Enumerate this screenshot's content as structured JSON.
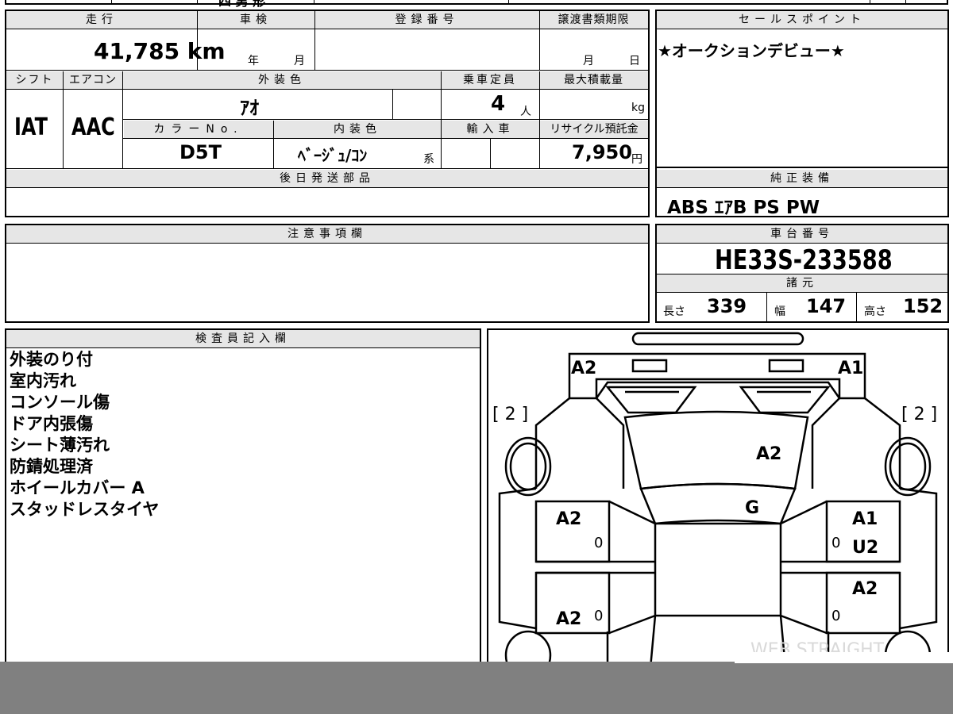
{
  "top_strip": {
    "partial_text": "四 男 形"
  },
  "mileage": {
    "label": "走行",
    "value": "41,785 km"
  },
  "shaken": {
    "label": "車検",
    "year_unit": "年",
    "month_unit": "月"
  },
  "registration": {
    "label": "登録番号",
    "value": ""
  },
  "transfer_deadline": {
    "label": "譲渡書類期限",
    "month_unit": "月",
    "day_unit": "日"
  },
  "shift": {
    "label": "シフト",
    "value": "IAT"
  },
  "aircon": {
    "label": "エアコン",
    "value": "AAC"
  },
  "exterior_color": {
    "label": "外装色",
    "value": "ｱｵ"
  },
  "capacity": {
    "label": "乗車定員",
    "value": "4",
    "unit": "人"
  },
  "max_load": {
    "label": "最大積載量",
    "unit": "kg"
  },
  "color_no": {
    "label": "カラーNo.",
    "value": "D5T"
  },
  "interior_color": {
    "label": "内装色",
    "value": "ﾍﾞｰｼﾞｭ/ｺﾝ",
    "suffix": "系"
  },
  "import": {
    "label": "輸入車"
  },
  "recycle": {
    "label": "リサイクル預託金",
    "value": "7,950",
    "unit": "円"
  },
  "later_parts": {
    "label": "後日発送部品"
  },
  "sales_point": {
    "label": "セールスポイント",
    "value": "★オークションデビュー★"
  },
  "equipment": {
    "label": "純正装備",
    "value": "ABS ｴｱB PS PW"
  },
  "notes": {
    "label": "注意事項欄"
  },
  "chassis": {
    "label": "車台番号",
    "value": "HE33S-233588"
  },
  "specs": {
    "label": "諸元",
    "length_label": "長さ",
    "length": "339",
    "width_label": "幅",
    "width": "147",
    "height_label": "高さ",
    "height": "152"
  },
  "inspector": {
    "label": "検査員記入欄",
    "items": [
      "外装のり付",
      "室内汚れ",
      "コンソール傷",
      "ドア内張傷",
      "シート薄汚れ",
      "防錆処理済",
      "ホイールカバー A",
      "スタッドレスタイヤ"
    ]
  },
  "diagram": {
    "front_left_corner": "A2",
    "front_right_corner": "A1",
    "tire_left": "[ 2 ]",
    "tire_right": "[ 2 ]",
    "hood": "A2",
    "windshield": "G",
    "left_front_door": "A2",
    "left_front_door_mark": "0",
    "left_rear_door": "A2",
    "left_rear_door_mark": "0",
    "right_front_door_1": "A1",
    "right_front_door_2": "U2",
    "right_front_door_mark": "0",
    "right_rear_door": "A2",
    "right_rear_door_mark": "0",
    "watermark": "WEB STRAIGHT"
  }
}
